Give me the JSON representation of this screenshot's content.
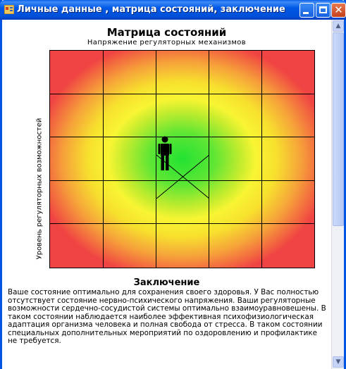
{
  "window": {
    "title": "Личные данные , матрица состояний, заключение - Лёш...",
    "controls": {
      "minimize_icon": "minimize-icon",
      "maximize_icon": "maximize-icon",
      "close_icon": "close-icon"
    }
  },
  "matrix": {
    "title": "Матрица состояний",
    "x_label": "Напряжение регуляторных механизмов",
    "y_label": "Уровень регуляторных возможностей",
    "grid": {
      "rows": 5,
      "cols": 5
    },
    "marker": {
      "icon": "person-icon",
      "row": 3,
      "col": 3
    },
    "colors": {
      "center": "#22e233",
      "middle": "#f8f533",
      "edge": "#f04343"
    }
  },
  "conclusion": {
    "title": "Заключение",
    "text": "Ваше состояние оптимально для сохранения своего здоровья. У Вас полностью отсутствует состояние нервно-психического напряжения. Ваши регуляторные возможности сердечно-сосудистой системы оптимально взаимоуравновешены. В таком состоянии наблюдается наиболее эффективная психофизиологическая адаптация организма человека и полная свобода от стресса. В таком состоянии специальных дополнительных мероприятий по оздоровлению и профилактике не требуется."
  }
}
